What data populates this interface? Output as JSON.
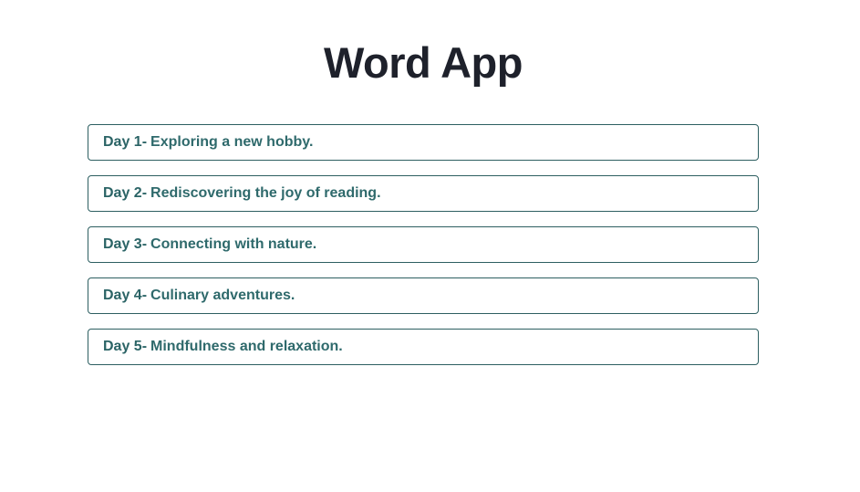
{
  "app": {
    "title": "Word App"
  },
  "days": [
    {
      "label": "Day 1-",
      "text": "Exploring a new hobby."
    },
    {
      "label": "Day 2-",
      "text": "Rediscovering the joy of reading."
    },
    {
      "label": "Day 3-",
      "text": "Connecting with nature."
    },
    {
      "label": "Day 4-",
      "text": "Culinary adventures."
    },
    {
      "label": "Day 5-",
      "text": "Mindfulness and relaxation."
    }
  ],
  "colors": {
    "title": "#1e212b",
    "accent": "#2b6466",
    "border": "#2d5f61",
    "background": "#ffffff"
  }
}
